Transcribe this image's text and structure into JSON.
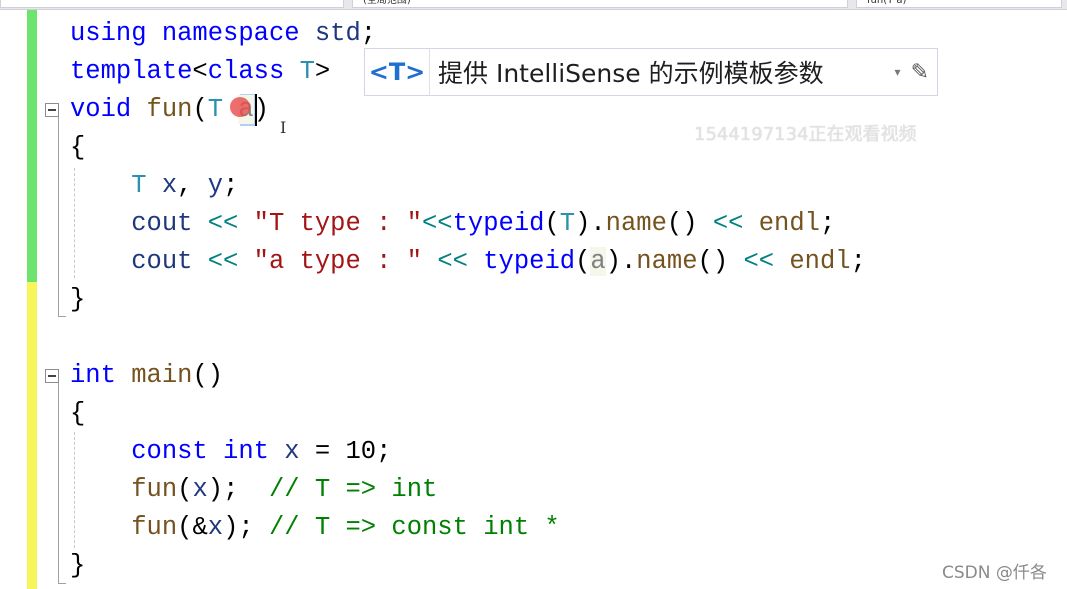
{
  "topbar": {
    "scope_dropdown": "(全局范围)",
    "member_dropdown": "fun(T a)"
  },
  "tooltip": {
    "badge": "<T>",
    "text": "提供 IntelliSense 的示例模板参数",
    "arrow": "▾",
    "pen": "✎"
  },
  "watermark": "1544197134正在观看视频",
  "credit": "CSDN @仟各",
  "colors": {
    "keyword": "#0000ff",
    "type": "#2b91af",
    "string": "#a31515",
    "comment": "#008000",
    "function": "#74531f",
    "changed_gutter": "#6ee36e",
    "saved_gutter": "#f6f65a"
  },
  "code_lines": [
    [
      [
        "kw",
        "using"
      ],
      [
        "pl",
        " "
      ],
      [
        "kw",
        "namespace"
      ],
      [
        "pl",
        " "
      ],
      [
        "var",
        "std"
      ],
      [
        "pl",
        ";"
      ]
    ],
    [
      [
        "kw",
        "template"
      ],
      [
        "pl",
        "<"
      ],
      [
        "kw",
        "class"
      ],
      [
        "pl",
        " "
      ],
      [
        "ty",
        "T"
      ],
      [
        "pl",
        ">"
      ]
    ],
    [
      [
        "kw",
        "void"
      ],
      [
        "pl",
        " "
      ],
      [
        "fn",
        "fun"
      ],
      [
        "pl",
        "("
      ],
      [
        "ty",
        "T"
      ],
      [
        "pl",
        " "
      ],
      [
        "param",
        "a"
      ],
      [
        "pl",
        ")"
      ]
    ],
    [
      [
        "pl",
        "{"
      ]
    ],
    [
      [
        "pl",
        "    "
      ],
      [
        "ty",
        "T"
      ],
      [
        "pl",
        " "
      ],
      [
        "var",
        "x"
      ],
      [
        "pl",
        ", "
      ],
      [
        "var",
        "y"
      ],
      [
        "pl",
        ";"
      ]
    ],
    [
      [
        "pl",
        "    "
      ],
      [
        "var",
        "cout"
      ],
      [
        "pl",
        " "
      ],
      [
        "op",
        "<<"
      ],
      [
        "pl",
        " "
      ],
      [
        "str",
        "\"T type : \""
      ],
      [
        "op",
        "<<"
      ],
      [
        "kw",
        "typeid"
      ],
      [
        "pl",
        "("
      ],
      [
        "ty",
        "T"
      ],
      [
        "pl",
        ")."
      ],
      [
        "fn",
        "name"
      ],
      [
        "pl",
        "() "
      ],
      [
        "op",
        "<<"
      ],
      [
        "pl",
        " "
      ],
      [
        "fn",
        "endl"
      ],
      [
        "pl",
        ";"
      ]
    ],
    [
      [
        "pl",
        "    "
      ],
      [
        "var",
        "cout"
      ],
      [
        "pl",
        " "
      ],
      [
        "op",
        "<<"
      ],
      [
        "pl",
        " "
      ],
      [
        "str",
        "\"a type : \""
      ],
      [
        "pl",
        " "
      ],
      [
        "op",
        "<<"
      ],
      [
        "pl",
        " "
      ],
      [
        "kw",
        "typeid"
      ],
      [
        "pl",
        "("
      ],
      [
        "param",
        "a"
      ],
      [
        "pl",
        ")."
      ],
      [
        "fn",
        "name"
      ],
      [
        "pl",
        "() "
      ],
      [
        "op",
        "<<"
      ],
      [
        "pl",
        " "
      ],
      [
        "fn",
        "endl"
      ],
      [
        "pl",
        ";"
      ]
    ],
    [
      [
        "pl",
        "}"
      ]
    ],
    [
      [
        "pl",
        " "
      ]
    ],
    [
      [
        "kw",
        "int"
      ],
      [
        "pl",
        " "
      ],
      [
        "fn",
        "main"
      ],
      [
        "pl",
        "()"
      ]
    ],
    [
      [
        "pl",
        "{"
      ]
    ],
    [
      [
        "pl",
        "    "
      ],
      [
        "kw",
        "const"
      ],
      [
        "pl",
        " "
      ],
      [
        "kw",
        "int"
      ],
      [
        "pl",
        " "
      ],
      [
        "var",
        "x"
      ],
      [
        "pl",
        " = 10;"
      ]
    ],
    [
      [
        "pl",
        "    "
      ],
      [
        "fn",
        "fun"
      ],
      [
        "pl",
        "("
      ],
      [
        "var",
        "x"
      ],
      [
        "pl",
        ");  "
      ],
      [
        "cm",
        "// T => int"
      ]
    ],
    [
      [
        "pl",
        "    "
      ],
      [
        "fn",
        "fun"
      ],
      [
        "pl",
        "(&"
      ],
      [
        "var",
        "x"
      ],
      [
        "pl",
        "); "
      ],
      [
        "cm",
        "// T => const int *"
      ]
    ],
    [
      [
        "pl",
        "}"
      ]
    ]
  ]
}
